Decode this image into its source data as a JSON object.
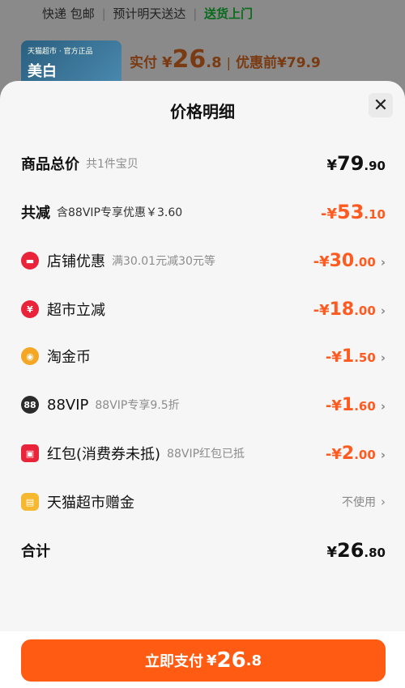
{
  "background": {
    "shipping": {
      "part1": "快递 包邮",
      "part2": "预计明天送达",
      "part3": "送货上门"
    },
    "thumb": {
      "line1": "天猫超市 · 官方正品",
      "line2": "美白"
    },
    "price": {
      "label": "实付",
      "currency": "¥",
      "int": "26",
      "dec": ".8",
      "sep": "|",
      "orig": "优惠前¥79.9"
    }
  },
  "sheet": {
    "title": "价格明细",
    "close": "✕",
    "rows": [
      {
        "name": "商品总价",
        "sub": "共1件宝贝",
        "cur": "¥",
        "int": "79",
        "dec": ".90"
      },
      {
        "name": "共减",
        "sub": "含88VIP专享优惠￥3.60",
        "cur": "-¥",
        "int": "53",
        "dec": ".10"
      },
      {
        "name": "店铺优惠",
        "sub": "满30.01元减30元等",
        "cur": "-¥",
        "int": "30",
        "dec": ".00",
        "icon": "shop-coupon-icon",
        "icon_color": "#e8233a"
      },
      {
        "name": "超市立减",
        "sub": "",
        "cur": "-¥",
        "int": "18",
        "dec": ".00",
        "icon": "supermarket-discount-icon",
        "icon_color": "#e8233a"
      },
      {
        "name": "淘金币",
        "sub": "",
        "cur": "-¥",
        "int": "1",
        "dec": ".50",
        "icon": "gold-coin-icon",
        "icon_color": "#f5a623"
      },
      {
        "name": "88VIP",
        "sub": "88VIP专享9.5折",
        "cur": "-¥",
        "int": "1",
        "dec": ".60",
        "icon": "vip-88-icon",
        "icon_color": "#2b2b2b",
        "icon_text": "88"
      },
      {
        "name": "红包(消费券未抵)",
        "sub": "88VIP红包已抵",
        "cur": "-¥",
        "int": "2",
        "dec": ".00",
        "icon": "red-packet-icon",
        "icon_color": "#e8233a"
      },
      {
        "name": "天猫超市赠金",
        "sub": "",
        "status": "不使用",
        "icon": "gift-money-icon",
        "icon_color": "#f5b82e"
      },
      {
        "name": "合计",
        "sub": "",
        "cur": "¥",
        "int": "26",
        "dec": ".80"
      }
    ],
    "chevron": "›",
    "pay_button": {
      "label": "立即支付",
      "cur": "¥",
      "int": "26",
      "dec": ".8"
    }
  },
  "colors": {
    "accent": "#ff5b12",
    "discount": "#ff5a1f",
    "brand_red": "#e8233a"
  }
}
